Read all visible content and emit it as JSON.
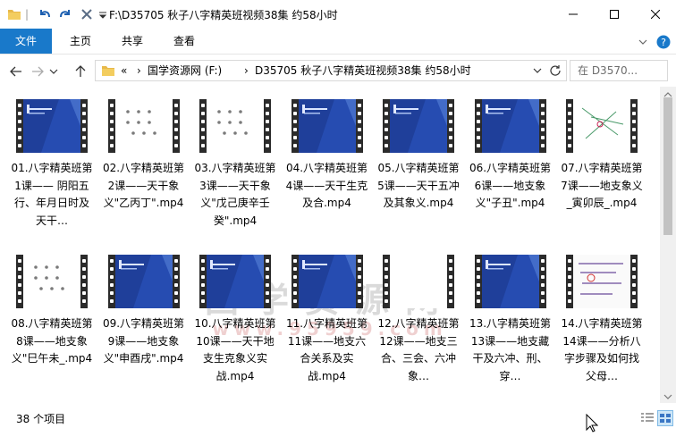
{
  "window": {
    "title": "F:\\D35705 秋子八字精英班视频38集 约58小时"
  },
  "ribbon": {
    "tabs": [
      "文件",
      "主页",
      "共享",
      "查看"
    ]
  },
  "address": {
    "overflow": "«",
    "crumbs": [
      "国学资源网 (F:)",
      "D35705 秋子八字精英班视频38集 约58小时"
    ],
    "search_placeholder": "在 D3570..."
  },
  "files": [
    {
      "name": "01.八字精英班第1课—— 阴阳五行、年月日时及天干…",
      "thumb": "blue-slide"
    },
    {
      "name": "02.八字精英班第2课——天干象义\"乙丙丁\".mp4",
      "thumb": "white-dots"
    },
    {
      "name": "03.八字精英班第3课——天干象义\"戊己庚辛壬癸\".mp4",
      "thumb": "white-dots"
    },
    {
      "name": "04.八字精英班第4课——天干生克及合.mp4",
      "thumb": "blue-slide"
    },
    {
      "name": "05.八字精英班第5课——天干五冲及其象义.mp4",
      "thumb": "blue-slide"
    },
    {
      "name": "06.八字精英班第6课——地支象义\"子丑\".mp4",
      "thumb": "blue-slide"
    },
    {
      "name": "07.八字精英班第7课——地支象义_寅卯辰_.mp4",
      "thumb": "white-lines"
    },
    {
      "name": "08.八字精英班第8课——地支象义\"巳午未_.mp4",
      "thumb": "white-dots"
    },
    {
      "name": "09.八字精英班第9课——地支象义\"申酉戌\".mp4",
      "thumb": "blue-slide"
    },
    {
      "name": "10.八字精英班第10课——天干地支生克象义实战.mp4",
      "thumb": "blue-slide"
    },
    {
      "name": "11.八字精英班第11课——地支六合关系及实战.mp4",
      "thumb": "blue-slide"
    },
    {
      "name": "12.八字精英班第12课——地支三合、三会、六冲象…",
      "thumb": "white-blank"
    },
    {
      "name": "13.八字精英班第13课——地支藏干及六冲、刑、穿…",
      "thumb": "blue-slide"
    },
    {
      "name": "14.八字精英班第14课——分析八字步骤及如何找父母…",
      "thumb": "white-hand"
    }
  ],
  "watermark": {
    "line1": "国学资源网",
    "line2": "www.95959.com"
  },
  "status": {
    "count": "38 个项目"
  },
  "colors": {
    "accent": "#1979ca",
    "slide_blue": "#1f3f9a",
    "film": "#2b2b2b"
  }
}
